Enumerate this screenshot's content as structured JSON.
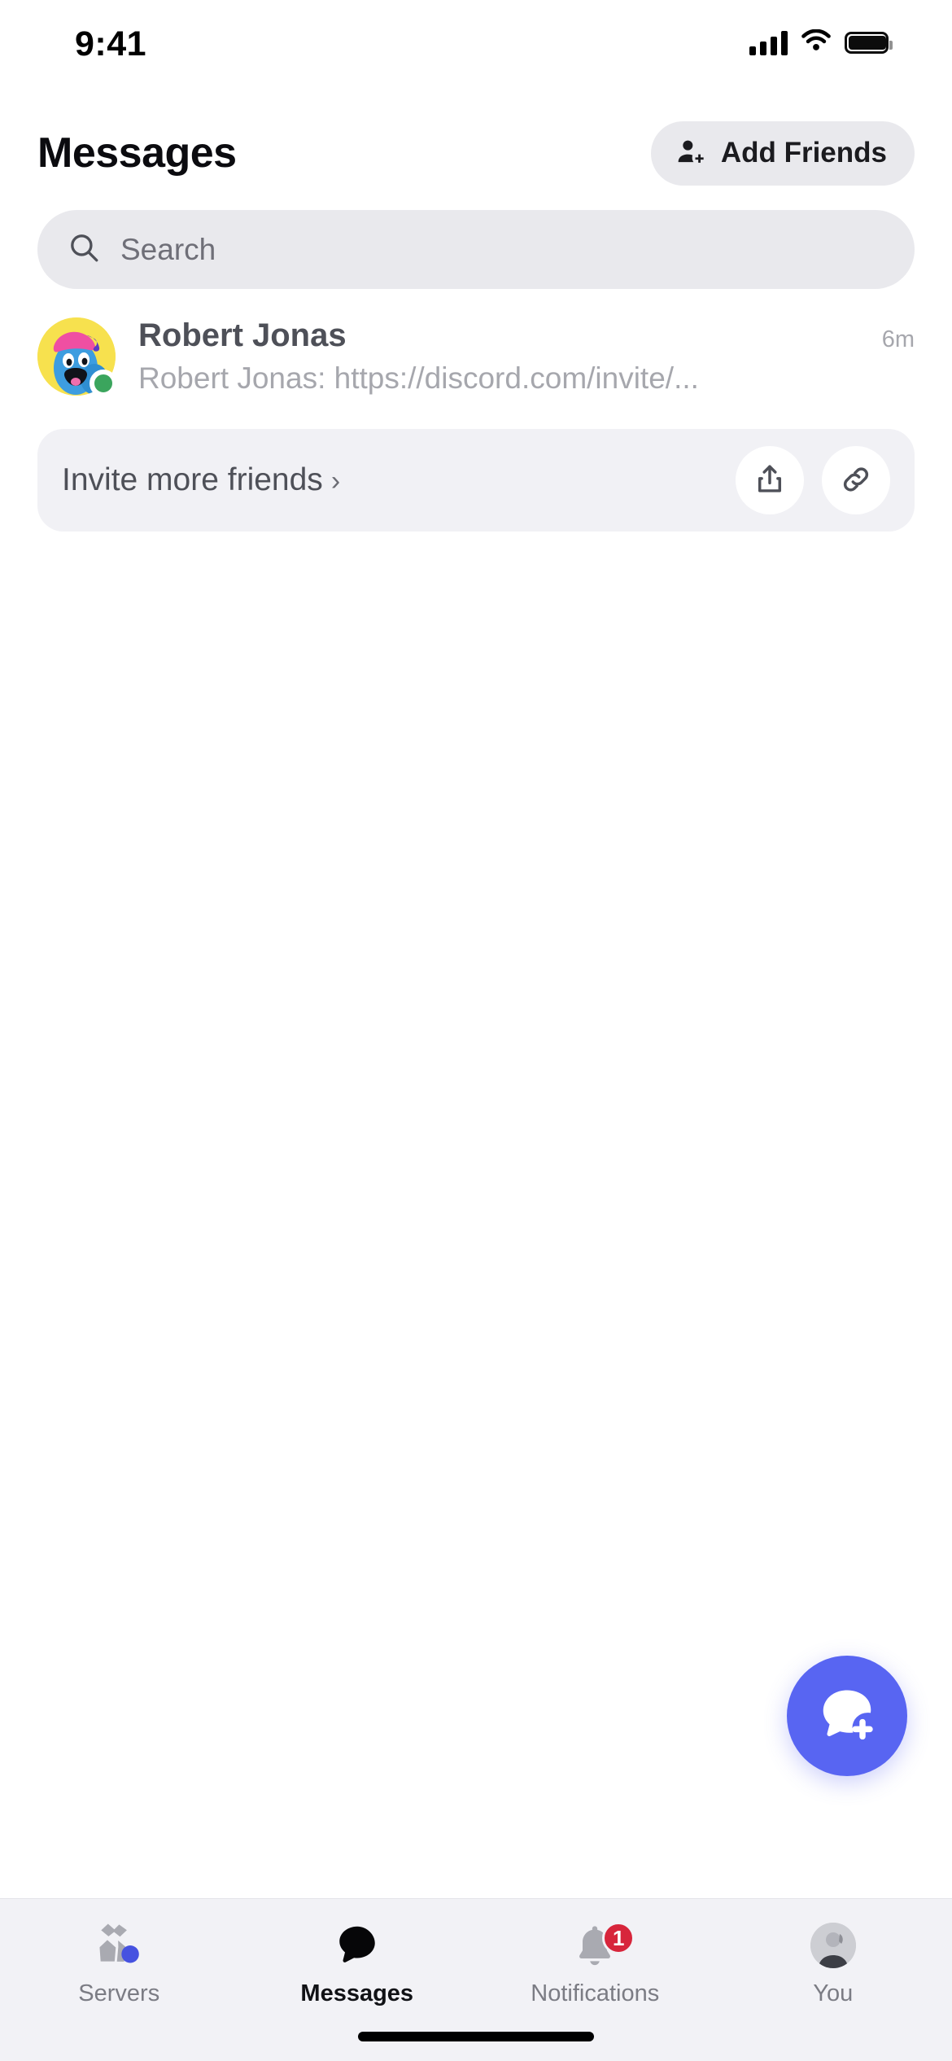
{
  "status_bar": {
    "time": "9:41",
    "icons": [
      "cellular-signal-icon",
      "wifi-icon",
      "battery-icon"
    ]
  },
  "header": {
    "title": "Messages",
    "add_friends_label": "Add Friends",
    "add_friends_icon": "person-add-icon"
  },
  "search": {
    "placeholder": "Search",
    "icon": "search-icon",
    "value": ""
  },
  "conversations": [
    {
      "name": "Robert Jonas",
      "preview": "Robert Jonas: https://discord.com/invite/...",
      "time": "6m",
      "presence": "online",
      "avatar": "cartoon-blue-character-avatar"
    }
  ],
  "invite_card": {
    "label": "Invite more friends",
    "chevron": "›",
    "actions": [
      {
        "name": "share-button",
        "icon": "share-icon"
      },
      {
        "name": "copy-link-button",
        "icon": "link-icon"
      }
    ]
  },
  "fab": {
    "name": "new-message-button",
    "icon": "new-message-icon",
    "color": "#5865f2"
  },
  "tab_bar": {
    "items": [
      {
        "label": "Servers",
        "icon": "servers-icon",
        "active": false,
        "badge": ""
      },
      {
        "label": "Messages",
        "icon": "messages-icon",
        "active": true,
        "badge": ""
      },
      {
        "label": "Notifications",
        "icon": "notifications-icon",
        "active": false,
        "badge": "1"
      },
      {
        "label": "You",
        "icon": "user-avatar-icon",
        "active": false,
        "badge": ""
      }
    ]
  },
  "colors": {
    "accent": "#5865f2",
    "badge": "#d7253b",
    "online": "#3ba55d",
    "surface": "#e9e9ed",
    "card": "#f1f1f5",
    "tabbar": "#f2f2f6"
  }
}
